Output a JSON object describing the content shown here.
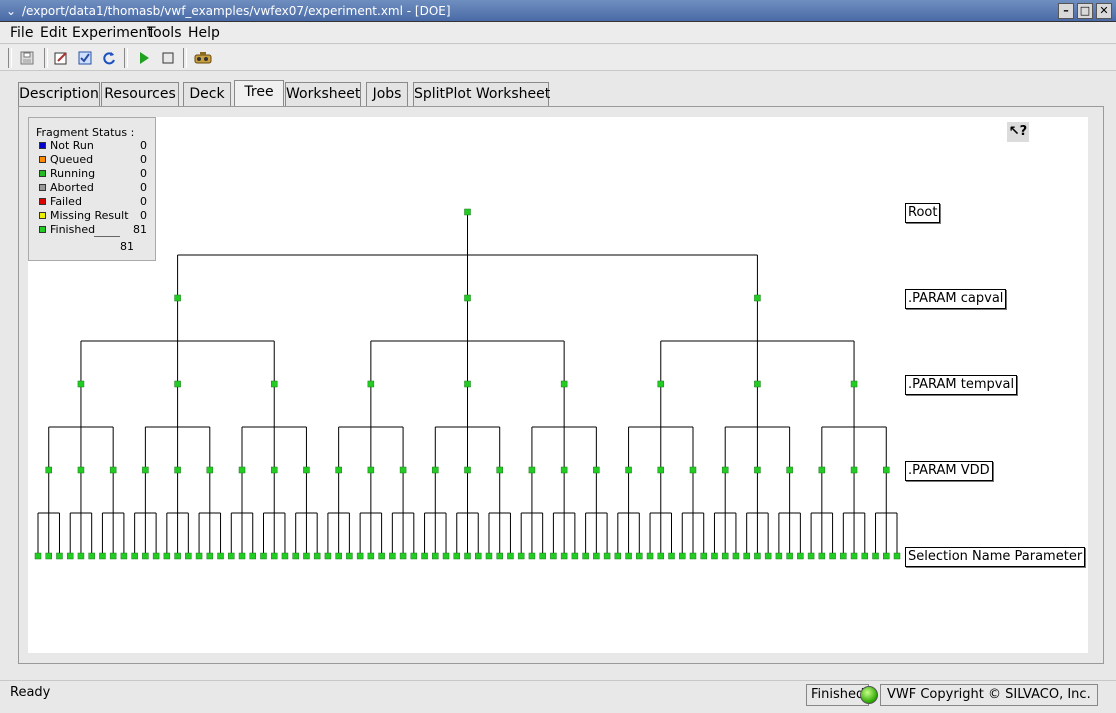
{
  "window": {
    "title": "/export/data1/thomasb/vwf_examples/vwfex07/experiment.xml - [DOE]"
  },
  "menu": [
    "File",
    "Edit",
    "Experiment",
    "Tools",
    "Help"
  ],
  "toolbar": {
    "icons": [
      "save-icon",
      "edit-icon",
      "check-icon",
      "refresh-icon",
      "run-icon",
      "stop-icon",
      "tool-icon"
    ]
  },
  "tabs": [
    "Description",
    "Resources",
    "Deck",
    "Tree",
    "Worksheet",
    "Jobs",
    "SplitPlot Worksheet"
  ],
  "active_tab": "Tree",
  "fragment_status": {
    "header": "Fragment Status :",
    "rows": [
      {
        "label": "Not Run",
        "count": "0",
        "color": "#0000cc"
      },
      {
        "label": "Queued",
        "count": "0",
        "color": "#ff8c00"
      },
      {
        "label": "Running",
        "count": "0",
        "color": "#22bb22"
      },
      {
        "label": "Aborted",
        "count": "0",
        "color": "#999999"
      },
      {
        "label": "Failed",
        "count": "0",
        "color": "#dd0000"
      },
      {
        "label": "Missing Result",
        "count": "0",
        "color": "#eeee00"
      },
      {
        "label": "Finished",
        "count": "81",
        "color": "#22cc22"
      }
    ],
    "total": "81"
  },
  "tree": {
    "levels": [
      {
        "label": "Root",
        "nodes": 1
      },
      {
        "label": ".PARAM capval",
        "nodes": 3
      },
      {
        "label": ".PARAM tempval",
        "nodes": 9
      },
      {
        "label": ".PARAM VDD",
        "nodes": 27
      },
      {
        "label": "Selection Name Parameter",
        "nodes": 81
      }
    ],
    "node_color": "#22cc22"
  },
  "status": {
    "ready": "Ready",
    "state": "Finished",
    "copyright": "VWF Copyright ©  SILVACO, Inc."
  }
}
